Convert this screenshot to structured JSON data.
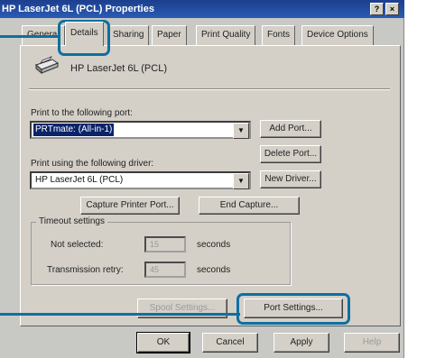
{
  "window": {
    "title": "HP LaserJet 6L (PCL) Properties",
    "help_btn": "?",
    "close_btn": "×"
  },
  "tabs": [
    {
      "label": "General"
    },
    {
      "label": "Details"
    },
    {
      "label": "Sharing"
    },
    {
      "label": "Paper"
    },
    {
      "label": "Print Quality"
    },
    {
      "label": "Fonts"
    },
    {
      "label": "Device Options"
    }
  ],
  "printer": {
    "name": "HP LaserJet 6L (PCL)",
    "icon": "printer-icon"
  },
  "port": {
    "label": "Print to the following port:",
    "value": "PRTmate: (All-in-1)",
    "add_port": "Add Port...",
    "delete_port": "Delete Port..."
  },
  "driver": {
    "label": "Print using the following driver:",
    "value": "HP LaserJet 6L (PCL)",
    "new_driver": "New Driver..."
  },
  "capture": {
    "capture_button": "Capture Printer Port...",
    "end_capture_button": "End Capture..."
  },
  "timeout": {
    "group_label": "Timeout settings",
    "not_selected_label": "Not selected:",
    "not_selected_value": "15",
    "retry_label": "Transmission retry:",
    "retry_value": "45",
    "unit": "seconds"
  },
  "spool": {
    "spool_settings": "Spool Settings...",
    "port_settings": "Port Settings..."
  },
  "footer": {
    "ok": "OK",
    "cancel": "Cancel",
    "apply": "Apply",
    "help": "Help"
  },
  "colors": {
    "callout": "#0f6fa0",
    "titlebar": "#1c3f8e",
    "selection": "#0a246a"
  }
}
